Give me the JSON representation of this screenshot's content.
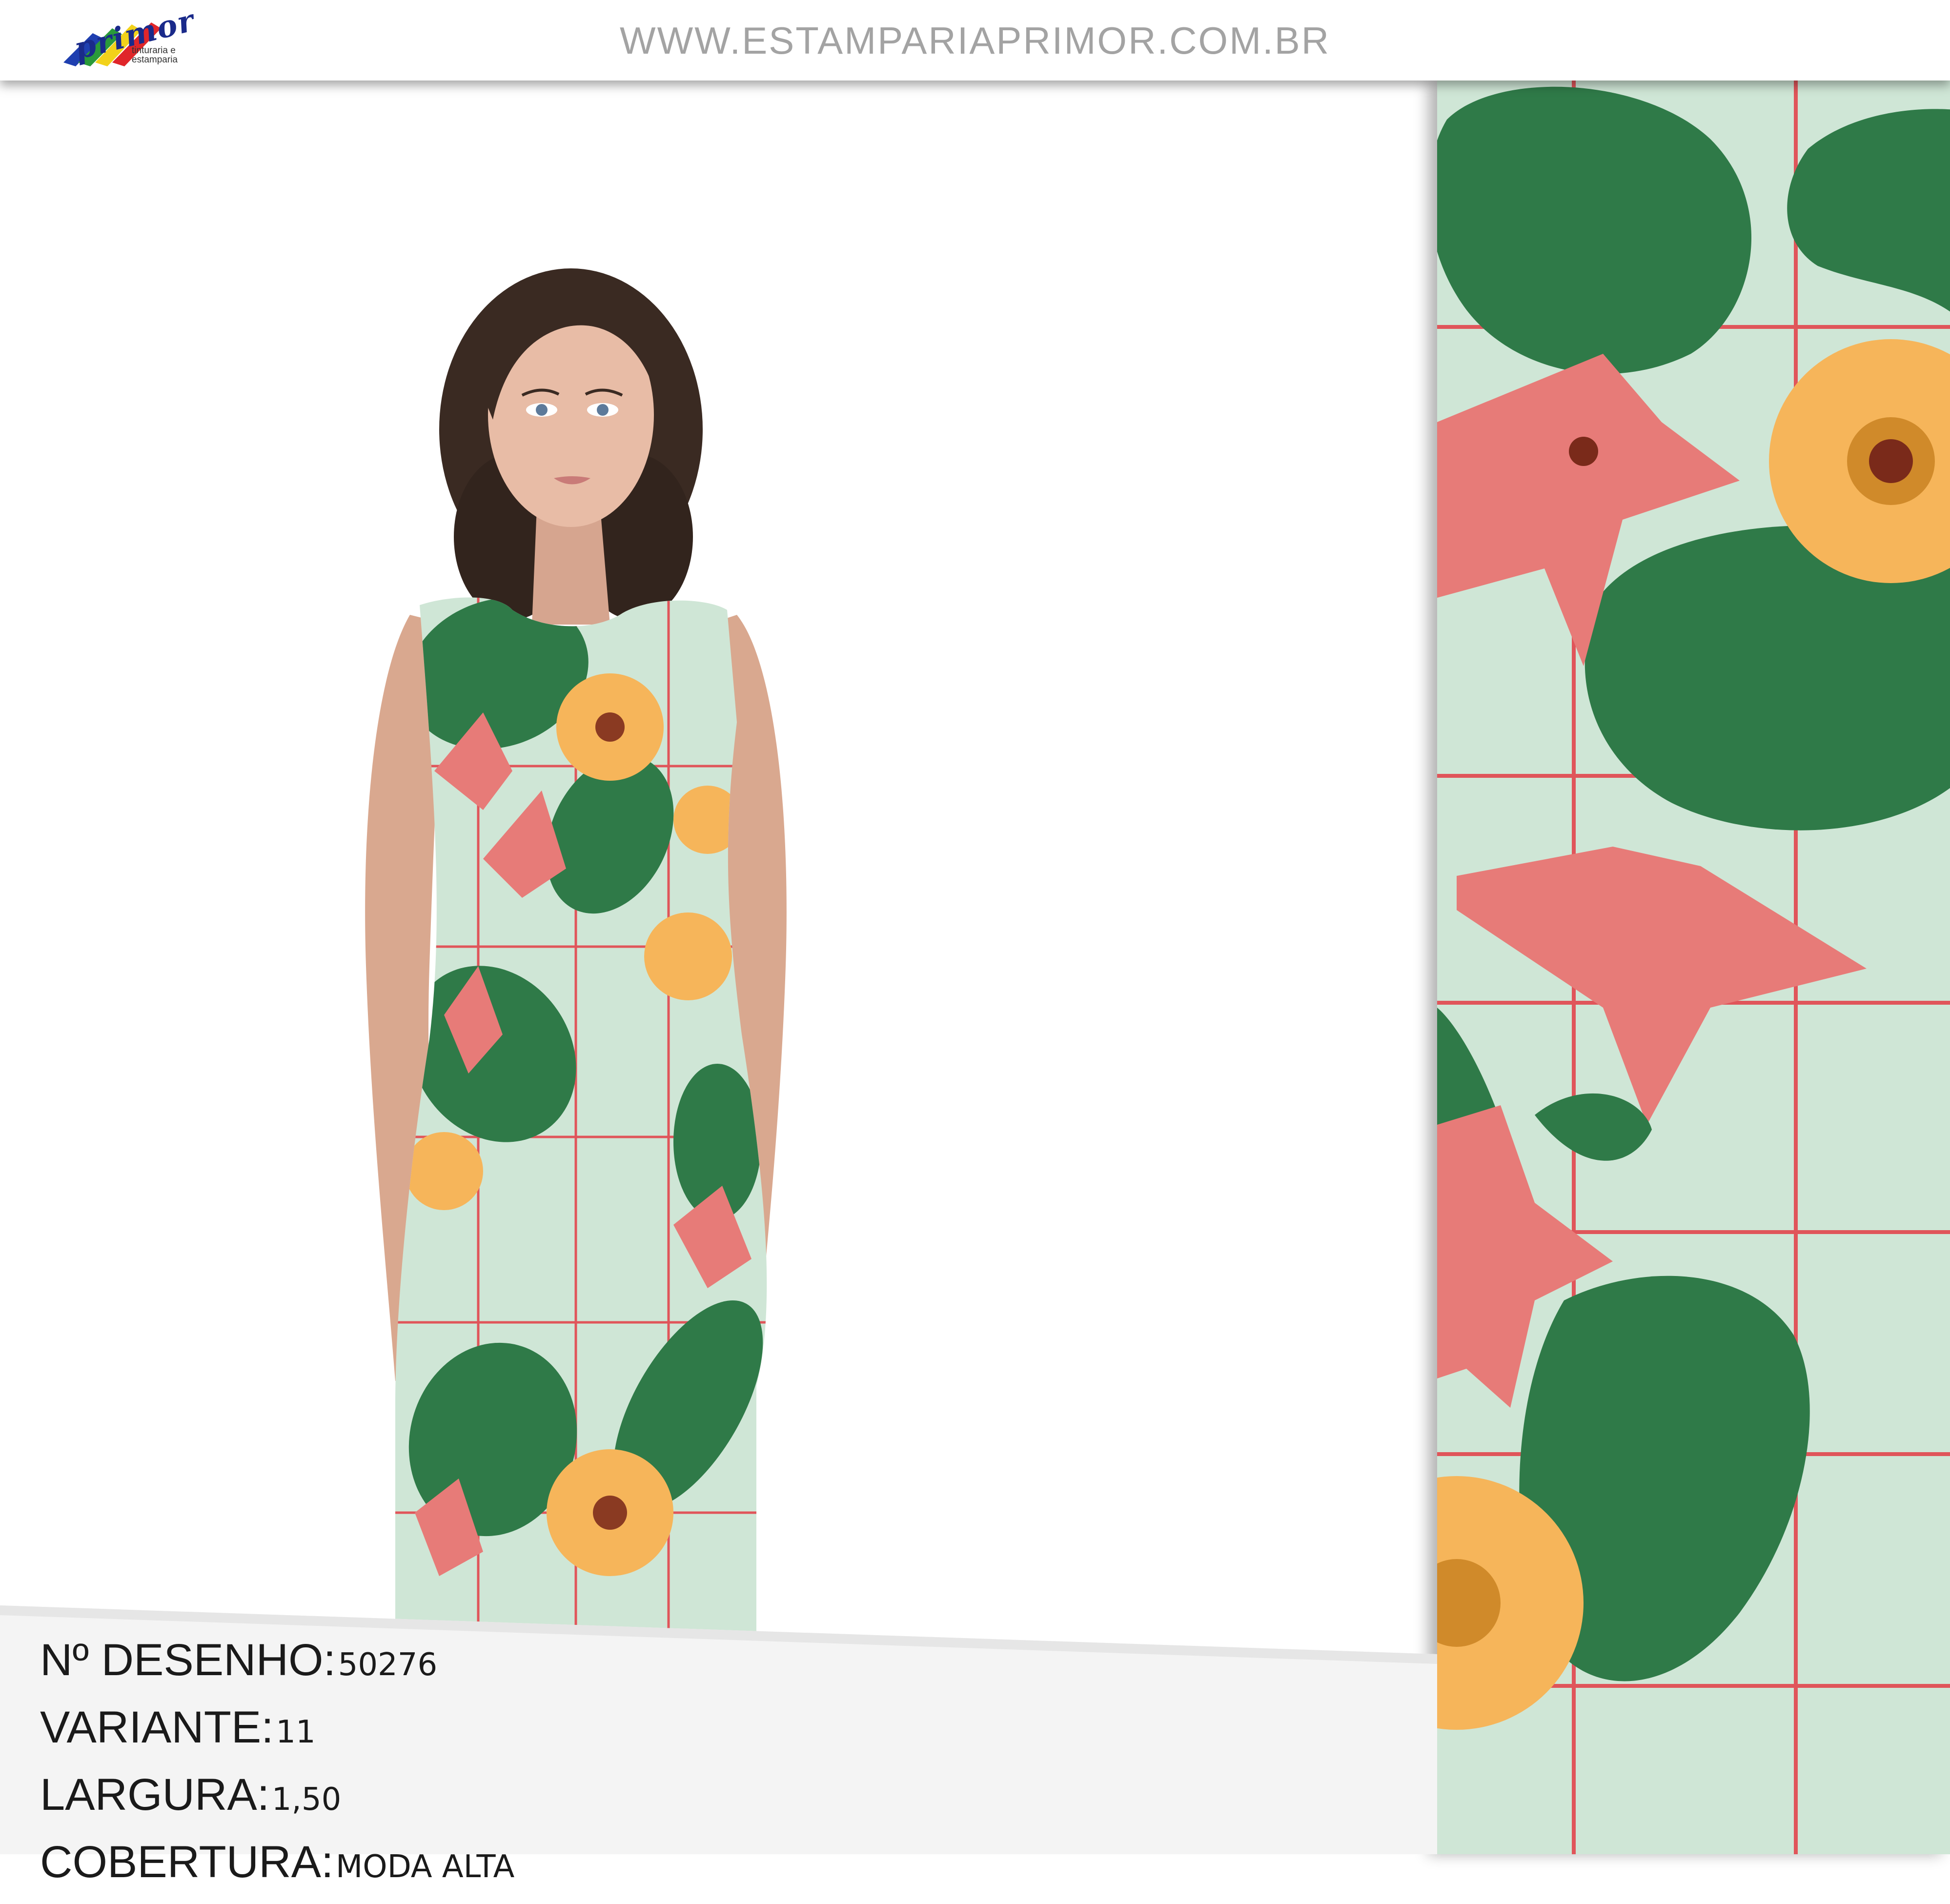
{
  "header": {
    "logo_text": "primor",
    "logo_sub_line1": "tinturaria e",
    "logo_sub_line2": "estamparia",
    "url": "WWW.ESTAMPARIAPRIMOR.COM.BR"
  },
  "info": {
    "desenho_label": "Nº DESENHO:",
    "desenho_value": "50276",
    "variante_label": "VARIANTE:",
    "variante_value": "11",
    "largura_label": "LARGURA:",
    "largura_value": "1,50",
    "cobertura_label": "COBERTURA:",
    "cobertura_value": "MODA ALTA"
  },
  "colors": {
    "background": "#cfe6d6",
    "grid_lines": "#e0555a",
    "leaf": "#2f7a48",
    "lily": "#e77b78",
    "flower": "#f6b55a"
  }
}
